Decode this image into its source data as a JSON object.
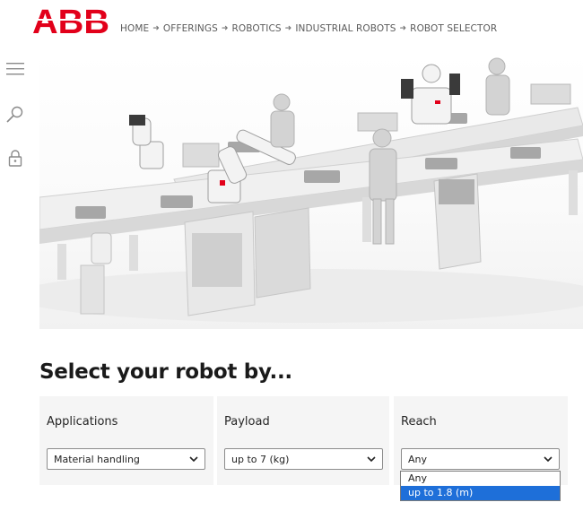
{
  "brand": {
    "logo_text": "ABB",
    "logo_color": "#e2001a"
  },
  "breadcrumb": [
    "HOME",
    "OFFERINGS",
    "ROBOTICS",
    "INDUSTRIAL ROBOTS",
    "ROBOT SELECTOR"
  ],
  "rail": {
    "icons": [
      "menu-icon",
      "search-icon",
      "lock-icon"
    ]
  },
  "hero": {
    "description_icon": "factory-robots-illustration"
  },
  "heading": "Select your robot by...",
  "filters": [
    {
      "label": "Applications",
      "selected": "Material handling"
    },
    {
      "label": "Payload",
      "selected": "up to 7 (kg)"
    },
    {
      "label": "Reach",
      "selected": "Any"
    }
  ],
  "reach_dropdown": {
    "options": [
      "Any",
      "up to 1.8 (m)"
    ],
    "highlighted": "up to 1.8 (m)",
    "highlight_color": "#1e6fd9"
  }
}
